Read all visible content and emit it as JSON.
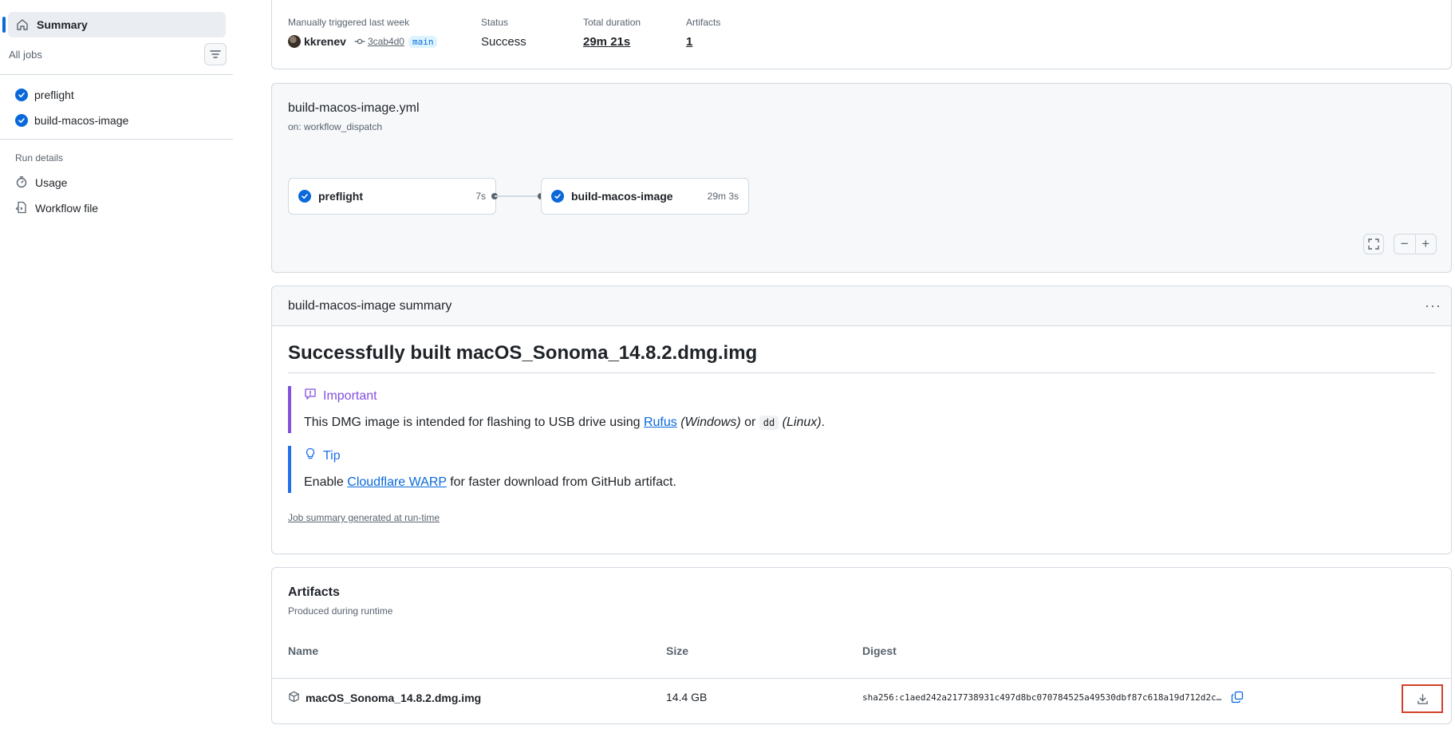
{
  "sidebar": {
    "summary_label": "Summary",
    "all_jobs_label": "All jobs",
    "jobs": [
      {
        "label": "preflight",
        "status": "success"
      },
      {
        "label": "build-macos-image",
        "status": "success"
      }
    ],
    "run_details_label": "Run details",
    "links": [
      {
        "label": "Usage",
        "icon": "stopwatch-icon"
      },
      {
        "label": "Workflow file",
        "icon": "file-code-icon"
      }
    ]
  },
  "run": {
    "trigger_label": "Manually triggered last week",
    "actor": "kkrenev",
    "commit_sha": "3cab4d0",
    "branch": "main",
    "status_label": "Status",
    "status_value": "Success",
    "duration_label": "Total duration",
    "duration_value": "29m 21s",
    "artifacts_label": "Artifacts",
    "artifacts_count": "1"
  },
  "workflow": {
    "file_name": "build-macos-image.yml",
    "trigger": "on: workflow_dispatch",
    "jobs": [
      {
        "name": "preflight",
        "duration": "7s"
      },
      {
        "name": "build-macos-image",
        "duration": "29m 3s"
      }
    ],
    "zoom_out_glyph": "−",
    "zoom_in_glyph": "+"
  },
  "job_summary": {
    "header": "build-macos-image summary",
    "heading": "Successfully built macOS_Sonoma_14.8.2.dmg.img",
    "important_title": "Important",
    "important_text_before": "This DMG image is intended for flashing to USB drive using ",
    "important_link": "Rufus",
    "important_windows": "(Windows)",
    "important_or": " or ",
    "important_code": "dd",
    "important_linux": "(Linux)",
    "important_end": ".",
    "tip_title": "Tip",
    "tip_text_before": "Enable ",
    "tip_link": "Cloudflare WARP",
    "tip_text_after": " for faster download from GitHub artifact.",
    "generated_note": "Job summary generated at run-time"
  },
  "artifacts": {
    "title": "Artifacts",
    "subtitle": "Produced during runtime",
    "columns": [
      "Name",
      "Size",
      "Digest"
    ],
    "rows": [
      {
        "name": "macOS_Sonoma_14.8.2.dmg.img",
        "size": "14.4 GB",
        "digest": "sha256:c1aed242a217738931c497d8bc070784525a49530dbf87c618a19d712d2c…"
      }
    ]
  },
  "colors": {
    "accent": "#0969da",
    "important": "#8250df",
    "tip": "#1f6feb",
    "highlight_box": "#d1402b"
  }
}
